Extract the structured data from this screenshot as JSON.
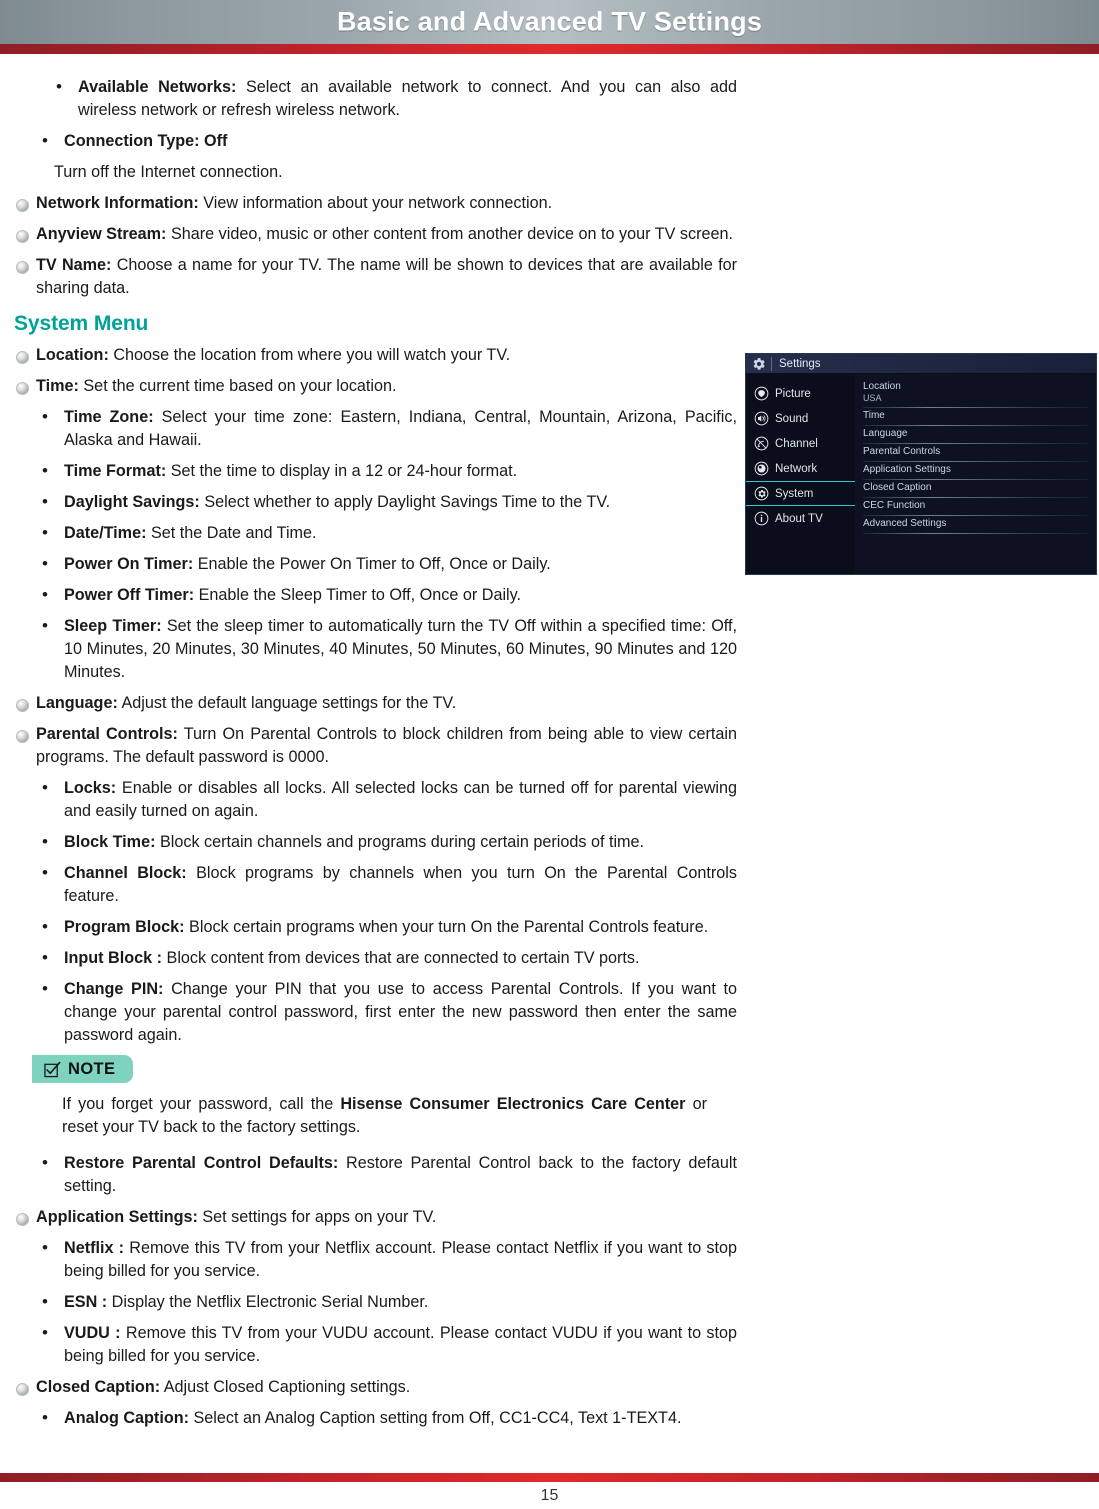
{
  "header": {
    "title": "Basic and Advanced TV Settings",
    "accent_gray": "#9aa6ab",
    "accent_red": "#d2232a"
  },
  "network_section": {
    "items": [
      {
        "level": 2,
        "term": "Available Networks:",
        "text": " Select an available network to connect. And you can also add wireless network or refresh wireless network."
      },
      {
        "level": 2,
        "term": "Connection Type: Off",
        "text": ""
      },
      {
        "level": "plain",
        "term": "",
        "text": "Turn off the Internet connection."
      },
      {
        "level": 1,
        "term": "Network Information:",
        "text": " View information about your network connection."
      },
      {
        "level": 1,
        "term": "Anyview Stream:",
        "text": " Share video, music or other content from another device on to your TV screen."
      },
      {
        "level": 1,
        "term": "TV Name:",
        "text": " Choose a name for your TV. The name will be shown to devices that are available for sharing data."
      }
    ]
  },
  "system_section": {
    "title": "System Menu",
    "title_color": "#00a396",
    "items": [
      {
        "level": 1,
        "term": "Location:",
        "text": " Choose the location from where you will watch your TV."
      },
      {
        "level": 1,
        "term": "Time:",
        "text": " Set the current time based on your location."
      },
      {
        "level": 2,
        "term": "Time Zone:",
        "text": " Select your time zone: Eastern, Indiana, Central, Mountain, Arizona, Pacific, Alaska and Hawaii."
      },
      {
        "level": 2,
        "term": "Time Format:",
        "text": " Set the time to display in a 12 or 24-hour format."
      },
      {
        "level": 2,
        "term": "Daylight Savings:",
        "text": " Select whether to apply Daylight Savings Time to the TV."
      },
      {
        "level": 2,
        "term": "Date/Time:",
        "text": " Set the Date and Time."
      },
      {
        "level": 2,
        "term": "Power On Timer:",
        "text": " Enable the Power On Timer to Off, Once or Daily."
      },
      {
        "level": 2,
        "term": "Power Off Timer:",
        "text": " Enable the Sleep Timer to Off, Once or Daily."
      },
      {
        "level": 2,
        "term": "Sleep Timer:",
        "text": "  Set the sleep timer to automatically turn the TV Off within a specified time: Off, 10 Minutes, 20 Minutes, 30 Minutes, 40 Minutes, 50 Minutes, 60 Minutes, 90 Minutes and 120 Minutes."
      },
      {
        "level": 1,
        "term": "Language:",
        "text": " Adjust the default language settings for the TV."
      },
      {
        "level": 1,
        "term": "Parental Controls:",
        "text": " Turn On Parental Controls to block children from being able to view certain programs. The default password is 0000."
      },
      {
        "level": 2,
        "term": "Locks:",
        "text": " Enable or disables all locks. All selected locks can be turned off for parental viewing and easily turned on again."
      },
      {
        "level": 2,
        "term": "Block Time:",
        "text": " Block certain channels and programs during certain periods of time."
      },
      {
        "level": 2,
        "term": "Channel Block:",
        "text": " Block programs by channels when you turn On the Parental Controls feature."
      },
      {
        "level": 2,
        "term": "Program Block:",
        "text": " Block certain programs when your turn On the Parental Controls feature."
      },
      {
        "level": 2,
        "term": "Input Block :",
        "text": " Block content from devices that are connected to certain TV ports."
      },
      {
        "level": 2,
        "term": "Change PIN:",
        "text": " Change your PIN that you use to access Parental Controls. If you want to change your parental control password, first enter the new password then enter the same password again."
      }
    ]
  },
  "note": {
    "label": "NOTE",
    "icon": "check-box-icon",
    "badge_color": "#7ed3bf",
    "body_pre": "If you forget your password, call the ",
    "body_bold": "Hisense Consumer Electronics Care Center",
    "body_post": " or reset your TV back to the factory settings."
  },
  "after_note_section": {
    "items": [
      {
        "level": 2,
        "term": "Restore Parental Control Defaults:",
        "text": " Restore Parental Control back to the factory default setting."
      },
      {
        "level": 1,
        "term": "Application Settings:",
        "text": " Set settings for apps on your TV."
      },
      {
        "level": 2,
        "term": "Netflix :",
        "text": " Remove this TV from your Netflix account. Please contact Netflix if you want to stop being billed for you service."
      },
      {
        "level": 2,
        "term": "ESN :",
        "text": " Display the Netflix Electronic Serial Number."
      },
      {
        "level": 2,
        "term": "VUDU :",
        "text": " Remove this TV from your VUDU account. Please contact VUDU if you want to stop being billed for you service."
      },
      {
        "level": 1,
        "term": "Closed Caption:",
        "text": " Adjust Closed Captioning settings."
      },
      {
        "level": 2,
        "term": "Analog Caption:",
        "text": " Select an Analog Caption setting from Off, CC1-CC4, Text 1-TEXT4."
      }
    ]
  },
  "tv_settings": {
    "title": "Settings",
    "title_icon": "gear-icon",
    "highlight_color": "#34c6d6",
    "sidebar": [
      {
        "label": "Picture",
        "icon": "picture-icon",
        "active": false
      },
      {
        "label": "Sound",
        "icon": "sound-icon",
        "active": false
      },
      {
        "label": "Channel",
        "icon": "channel-icon",
        "active": false
      },
      {
        "label": "Network",
        "icon": "network-icon",
        "active": false
      },
      {
        "label": "System",
        "icon": "system-icon",
        "active": true
      },
      {
        "label": "About TV",
        "icon": "info-icon",
        "active": false
      }
    ],
    "list": [
      {
        "label": "Location",
        "value": "USA"
      },
      {
        "label": "Time",
        "value": ""
      },
      {
        "label": "Language",
        "value": ""
      },
      {
        "label": "Parental Controls",
        "value": ""
      },
      {
        "label": "Application Settings",
        "value": ""
      },
      {
        "label": "Closed Caption",
        "value": ""
      },
      {
        "label": "CEC Function",
        "value": ""
      },
      {
        "label": "Advanced Settings",
        "value": ""
      }
    ]
  },
  "footer": {
    "page_number": "15"
  }
}
